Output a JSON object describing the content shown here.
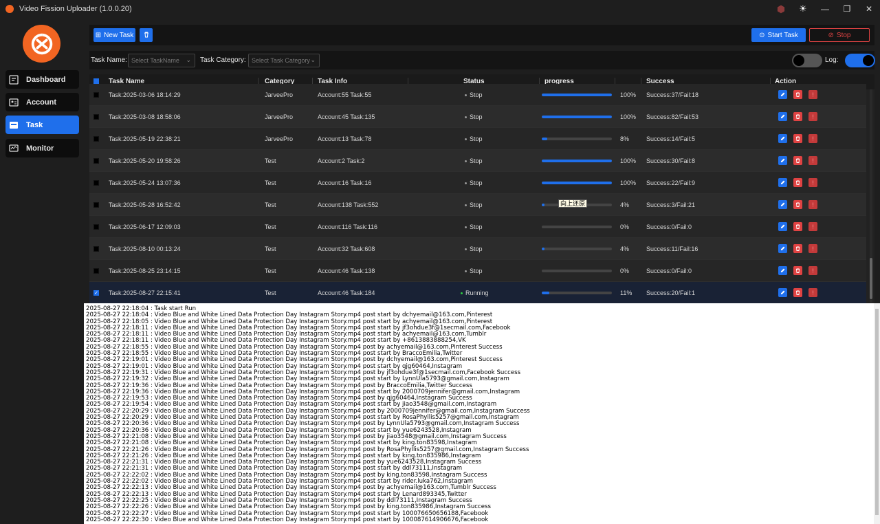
{
  "app": {
    "title": "Video Fission Uploader (1.0.0.20)"
  },
  "sidebar": {
    "items": [
      {
        "label": "Dashboard",
        "icon": "dashboard-icon",
        "active": false
      },
      {
        "label": "Account",
        "icon": "account-card-icon",
        "active": false
      },
      {
        "label": "Task",
        "icon": "task-icon",
        "active": true
      },
      {
        "label": "Monitor",
        "icon": "monitor-icon",
        "active": false
      }
    ]
  },
  "toolbar": {
    "new_task_label": "New Task",
    "start_task_label": "Start Task",
    "stop_label": "Stop"
  },
  "filters": {
    "task_name_label": "Task Name:",
    "task_name_placeholder": "Select TaskName",
    "task_category_label": "Task Category:",
    "task_category_placeholder": "Select Task Category",
    "log_label": "Log:",
    "toggle_left_on": false,
    "log_toggle_on": true
  },
  "table": {
    "headers": {
      "name": "Task Name",
      "category": "Category",
      "info": "Task Info",
      "status": "Status",
      "progress": "progress",
      "success": "Success",
      "action": "Action"
    },
    "rows": [
      {
        "name": "Task:2025-03-06 18:14:29",
        "category": "JarveePro",
        "info": "Account:55 Task:55",
        "status": "Stop",
        "progress": 100,
        "progress_text": "100%",
        "success": "Success:37/Fail:18",
        "checked": false
      },
      {
        "name": "Task:2025-03-08 18:58:06",
        "category": "JarveePro",
        "info": "Account:45 Task:135",
        "status": "Stop",
        "progress": 100,
        "progress_text": "100%",
        "success": "Success:82/Fail:53",
        "checked": false
      },
      {
        "name": "Task:2025-05-19 22:38:21",
        "category": "JarveePro",
        "info": "Account:13 Task:78",
        "status": "Stop",
        "progress": 8,
        "progress_text": "8%",
        "success": "Success:14/Fail:5",
        "checked": false
      },
      {
        "name": "Task:2025-05-20 19:58:26",
        "category": "Test",
        "info": "Account:2 Task:2",
        "status": "Stop",
        "progress": 100,
        "progress_text": "100%",
        "success": "Success:30/Fail:8",
        "checked": false
      },
      {
        "name": "Task:2025-05-24 13:07:36",
        "category": "Test",
        "info": "Account:16 Task:16",
        "status": "Stop",
        "progress": 100,
        "progress_text": "100%",
        "success": "Success:22/Fail:9",
        "checked": false
      },
      {
        "name": "Task:2025-05-28 16:52:42",
        "category": "Test",
        "info": "Account:138 Task:552",
        "status": "Stop",
        "progress": 4,
        "progress_text": "4%",
        "success": "Success:3/Fail:21",
        "checked": false
      },
      {
        "name": "Task:2025-06-17 12:09:03",
        "category": "Test",
        "info": "Account:116 Task:116",
        "status": "Stop",
        "progress": 0,
        "progress_text": "0%",
        "success": "Success:0/Fail:0",
        "checked": false
      },
      {
        "name": "Task:2025-08-10 00:13:24",
        "category": "Test",
        "info": "Account:32 Task:608",
        "status": "Stop",
        "progress": 4,
        "progress_text": "4%",
        "success": "Success:11/Fail:16",
        "checked": false
      },
      {
        "name": "Task:2025-08-25 23:14:15",
        "category": "Test",
        "info": "Account:46 Task:138",
        "status": "Stop",
        "progress": 0,
        "progress_text": "0%",
        "success": "Success:0/Fail:0",
        "checked": false
      },
      {
        "name": "Task:2025-08-27 22:15:41",
        "category": "Test",
        "info": "Account:46 Task:184",
        "status": "Running",
        "progress": 11,
        "progress_text": "11%",
        "success": "Success:20/Fail:1",
        "checked": true
      }
    ],
    "tooltip": "向上还原"
  },
  "colors": {
    "accent": "#1f6feb",
    "danger": "#e04343",
    "running": "#2ecc40",
    "brand": "#f26522"
  },
  "log": [
    "2025-08-27 22:18:04 : Task start Run",
    "2025-08-27 22:18:04 : Video Blue and White Lined Data Protection Day Instagram Story.mp4 post start by dchyemail@163.com,Pinterest",
    "2025-08-27 22:18:05 : Video Blue and White Lined Data Protection Day Instagram Story.mp4 post start by achyemail@163.com,Pinterest",
    "2025-08-27 22:18:11 : Video Blue and White Lined Data Protection Day Instagram Story.mp4 post start by jf3ohdue3f@1secmail.com,Facebook",
    "2025-08-27 22:18:11 : Video Blue and White Lined Data Protection Day Instagram Story.mp4 post start by achyemail@163.com,Tumblr",
    "2025-08-27 22:18:11 : Video Blue and White Lined Data Protection Day Instagram Story.mp4 post start by +8613883888254,VK",
    "2025-08-27 22:18:55 : Video Blue and White Lined Data Protection Day Instagram Story.mp4 post by achyemail@163.com,Pinterest Success",
    "2025-08-27 22:18:55 : Video Blue and White Lined Data Protection Day Instagram Story.mp4 post start by BraccoEmilia,Twitter",
    "2025-08-27 22:19:01 : Video Blue and White Lined Data Protection Day Instagram Story.mp4 post by dchyemail@163.com,Pinterest Success",
    "2025-08-27 22:19:01 : Video Blue and White Lined Data Protection Day Instagram Story.mp4 post start by qjg60464,Instagram",
    "2025-08-27 22:19:31 : Video Blue and White Lined Data Protection Day Instagram Story.mp4 post by jf3ohdue3f@1secmail.com,Facebook Success",
    "2025-08-27 22:19:32 : Video Blue and White Lined Data Protection Day Instagram Story.mp4 post start by LynnUla5793@gmail.com,Instagram",
    "2025-08-27 22:19:36 : Video Blue and White Lined Data Protection Day Instagram Story.mp4 post by BraccoEmilia,Twitter Success",
    "2025-08-27 22:19:36 : Video Blue and White Lined Data Protection Day Instagram Story.mp4 post start by 2000709jennifer@gmail.com,Instagram",
    "2025-08-27 22:19:53 : Video Blue and White Lined Data Protection Day Instagram Story.mp4 post by qjg60464,Instagram Success",
    "2025-08-27 22:19:54 : Video Blue and White Lined Data Protection Day Instagram Story.mp4 post start by jiao3548@gmail.com,Instagram",
    "2025-08-27 22:20:29 : Video Blue and White Lined Data Protection Day Instagram Story.mp4 post by 2000709jennifer@gmail.com,Instagram Success",
    "2025-08-27 22:20:29 : Video Blue and White Lined Data Protection Day Instagram Story.mp4 post start by RosaPhyllis5257@gmail.com,Instagram",
    "2025-08-27 22:20:36 : Video Blue and White Lined Data Protection Day Instagram Story.mp4 post by LynnUla5793@gmail.com,Instagram Success",
    "2025-08-27 22:20:36 : Video Blue and White Lined Data Protection Day Instagram Story.mp4 post start by yue6243528,Instagram",
    "2025-08-27 22:21:08 : Video Blue and White Lined Data Protection Day Instagram Story.mp4 post by jiao3548@gmail.com,Instagram Success",
    "2025-08-27 22:21:08 : Video Blue and White Lined Data Protection Day Instagram Story.mp4 post start by king.ton83598,Instagram",
    "2025-08-27 22:21:26 : Video Blue and White Lined Data Protection Day Instagram Story.mp4 post by RosaPhyllis5257@gmail.com,Instagram Success",
    "2025-08-27 22:21:26 : Video Blue and White Lined Data Protection Day Instagram Story.mp4 post start by king.ton835986,Instagram",
    "2025-08-27 22:21:31 : Video Blue and White Lined Data Protection Day Instagram Story.mp4 post by yue6243528,Instagram Success",
    "2025-08-27 22:21:31 : Video Blue and White Lined Data Protection Day Instagram Story.mp4 post start by ddl73111,Instagram",
    "2025-08-27 22:22:02 : Video Blue and White Lined Data Protection Day Instagram Story.mp4 post by king.ton83598,Instagram Success",
    "2025-08-27 22:22:02 : Video Blue and White Lined Data Protection Day Instagram Story.mp4 post start by rider.luka762,Instagram",
    "2025-08-27 22:22:13 : Video Blue and White Lined Data Protection Day Instagram Story.mp4 post by achyemail@163.com,Tumblr Success",
    "2025-08-27 22:22:13 : Video Blue and White Lined Data Protection Day Instagram Story.mp4 post start by Lenard893345,Twitter",
    "2025-08-27 22:22:25 : Video Blue and White Lined Data Protection Day Instagram Story.mp4 post by ddl73111,Instagram Success",
    "2025-08-27 22:22:26 : Video Blue and White Lined Data Protection Day Instagram Story.mp4 post by king.ton835986,Instagram Success",
    "2025-08-27 22:22:27 : Video Blue and White Lined Data Protection Day Instagram Story.mp4 post start by 100076650656188,Facebook",
    "2025-08-27 22:22:30 : Video Blue and White Lined Data Protection Day Instagram Story.mp4 post start by 100087614906676,Facebook"
  ]
}
